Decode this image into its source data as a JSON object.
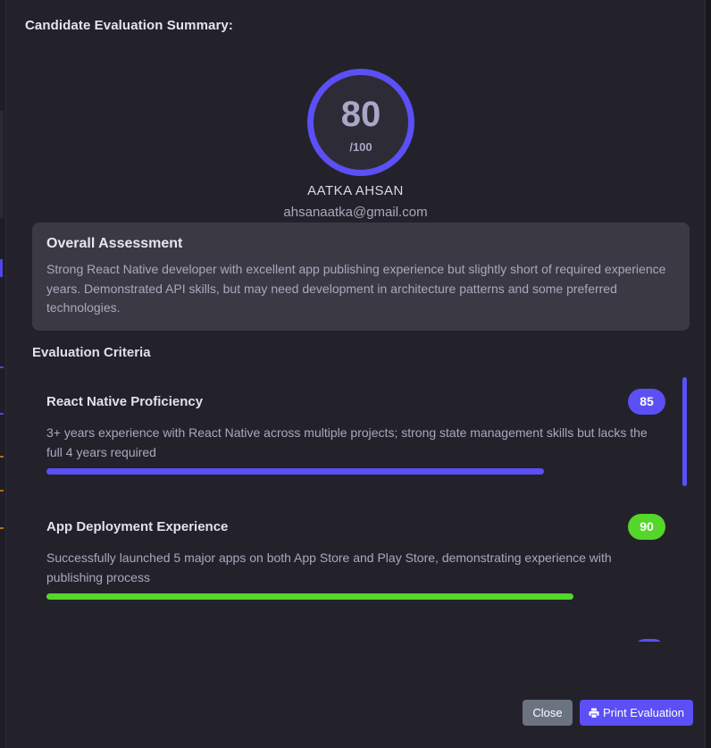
{
  "modal": {
    "title": "Candidate Evaluation Summary:"
  },
  "candidate": {
    "score": "80",
    "score_max": "/100",
    "name": "AATKA AHSAN",
    "email": "ahsanaatka@gmail.com"
  },
  "assessment": {
    "title": "Overall Assessment",
    "text": "Strong React Native developer with excellent app publishing experience but slightly short of required experience years. Demonstrated API skills, but may need development in architecture patterns and some preferred technologies."
  },
  "criteria": {
    "heading": "Evaluation Criteria",
    "items": [
      {
        "name": "React Native Proficiency",
        "score": "85",
        "description": "3+ years experience with React Native across multiple projects; strong state management skills but lacks the full 4 years required",
        "progress": 0.85,
        "color": "#5b4ff5"
      },
      {
        "name": "App Deployment Experience",
        "score": "90",
        "description": "Successfully launched 5 major apps on both App Store and Play Store, demonstrating experience with publishing process",
        "progress": 0.9,
        "color": "#55d62a"
      }
    ]
  },
  "footer": {
    "close_label": "Close",
    "print_label": "Print Evaluation",
    "print_icon": "printer-icon"
  },
  "colors": {
    "accent": "#5b4ff5",
    "success": "#55d62a",
    "close_button": "#6b7280"
  }
}
